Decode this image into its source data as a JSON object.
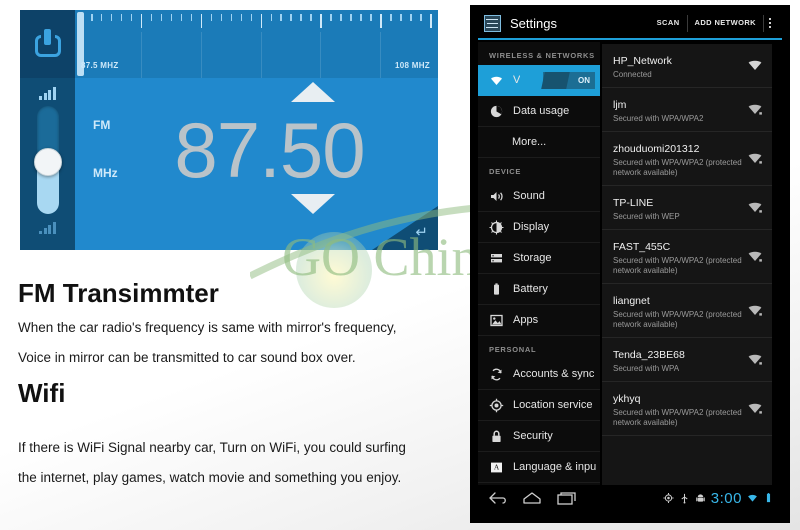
{
  "fm_panel": {
    "power_icon": "power-button-icon",
    "scale": {
      "min_label": "87.5 MHZ",
      "max_label": "108 MHZ"
    },
    "band_label": "FM",
    "unit_label": "MHz",
    "frequency": "87.50",
    "up_arrow": "tune-up-arrow",
    "down_arrow": "tune-down-arrow",
    "return_icon": "return-arrow-icon",
    "volume_icon_top": "signal-bars-icon",
    "volume_icon_bottom": "signal-bars-icon",
    "accent_color": "#2189cd",
    "sidebar_color": "#0f4d75"
  },
  "content": {
    "heading1": "FM Transimmter",
    "para1_line1": "When the car radio's frequency is same with mirror's frequency,",
    "para1_line2": "Voice in mirror can be transmitted to car sound box over.",
    "heading2": "Wifi",
    "para2_line1": "If there is WiFi Signal nearby car, Turn on WiFi, you could surfing",
    "para2_line2": "the internet, play games, watch movie and something you enjoy."
  },
  "watermark": {
    "text": "GO Chin"
  },
  "tablet": {
    "header": {
      "app_icon": "settings-sliders-icon",
      "title": "Settings",
      "scan_label": "SCAN",
      "add_network_label": "ADD NETWORK",
      "overflow_icon": "kebab-menu-icon",
      "accent_color": "#1e9fd8"
    },
    "sidebar": {
      "groups": [
        {
          "header": "WIRELESS & NETWORKS",
          "items": [
            {
              "label": "V",
              "icon": "wifi-icon",
              "selected": true,
              "toggle": "ON"
            },
            {
              "label": "Data usage",
              "icon": "pie-chart-icon",
              "selected": false
            },
            {
              "label": "More...",
              "icon": "",
              "selected": false,
              "indent": true
            }
          ]
        },
        {
          "header": "DEVICE",
          "items": [
            {
              "label": "Sound",
              "icon": "speaker-icon",
              "selected": false
            },
            {
              "label": "Display",
              "icon": "brightness-icon",
              "selected": false
            },
            {
              "label": "Storage",
              "icon": "storage-icon",
              "selected": false
            },
            {
              "label": "Battery",
              "icon": "battery-icon",
              "selected": false
            },
            {
              "label": "Apps",
              "icon": "apps-icon",
              "selected": false
            }
          ]
        },
        {
          "header": "PERSONAL",
          "items": [
            {
              "label": "Accounts & sync",
              "icon": "sync-icon",
              "selected": false
            },
            {
              "label": "Location service",
              "icon": "location-icon",
              "selected": false
            },
            {
              "label": "Security",
              "icon": "lock-icon",
              "selected": false
            },
            {
              "label": "Language & inpu",
              "icon": "language-icon",
              "selected": false
            }
          ]
        }
      ]
    },
    "wifi_networks": [
      {
        "ssid": "HP_Network",
        "status": "Connected",
        "secured": false
      },
      {
        "ssid": "ljm",
        "status": "Secured with WPA/WPA2",
        "secured": true
      },
      {
        "ssid": "zhouduomi201312",
        "status": "Secured with WPA/WPA2 (protected network available)",
        "secured": true
      },
      {
        "ssid": "TP-LINE",
        "status": "Secured with WEP",
        "secured": true
      },
      {
        "ssid": "FAST_455C",
        "status": "Secured with WPA/WPA2 (protected network available)",
        "secured": true
      },
      {
        "ssid": "liangnet",
        "status": "Secured with WPA/WPA2 (protected network available)",
        "secured": true
      },
      {
        "ssid": "Tenda_23BE68",
        "status": "Secured with WPA",
        "secured": true
      },
      {
        "ssid": "ykhyq",
        "status": "Secured with WPA/WPA2 (protected network available)",
        "secured": true
      }
    ],
    "navbar": {
      "back_icon": "back-arrow-icon",
      "home_icon": "home-icon",
      "recents_icon": "recent-apps-icon",
      "gps_icon": "gps-icon",
      "usb_icon": "usb-icon",
      "debug_icon": "android-debug-icon",
      "clock": "3:00",
      "wifi_icon": "wifi-status-icon",
      "battery_icon": "battery-status-icon"
    }
  }
}
